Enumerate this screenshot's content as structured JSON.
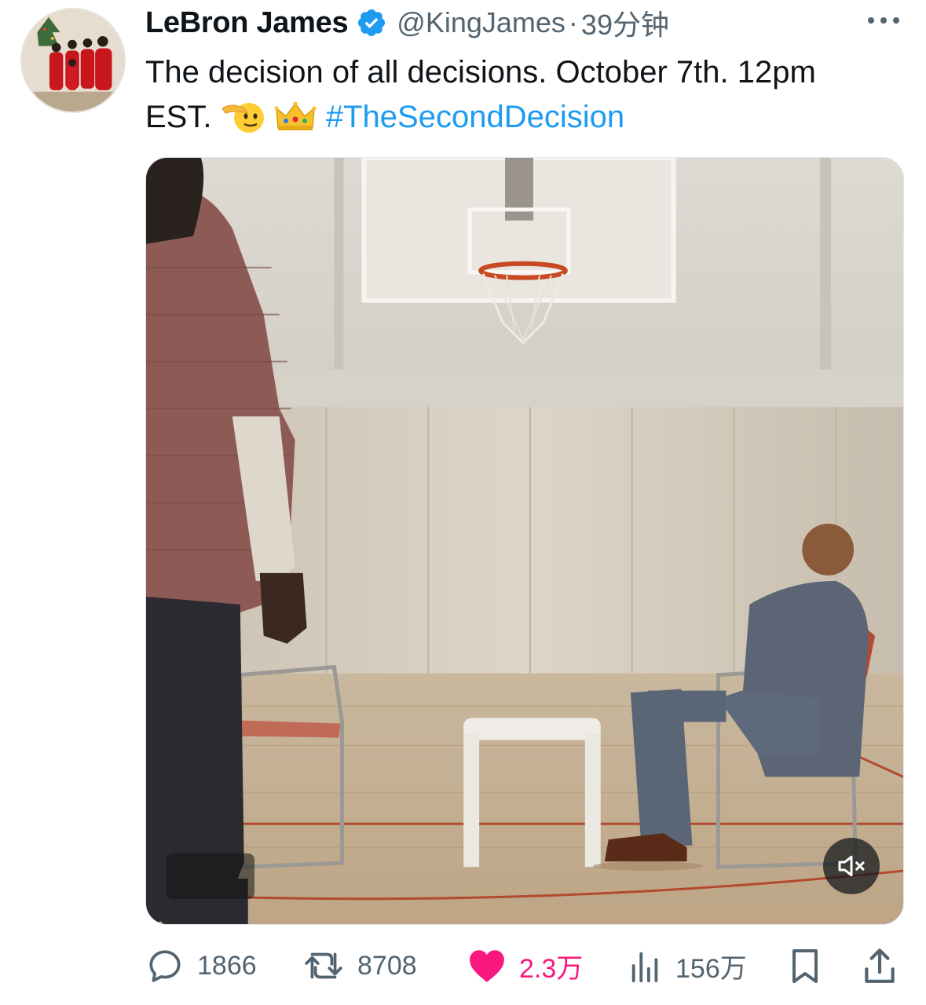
{
  "author": {
    "name": "LeBron James",
    "handle": "@KingJames",
    "separator": "·",
    "time": "39分钟",
    "verified": true
  },
  "tweet": {
    "text_line1": "The decision of all decisions. October 7th. 12pm",
    "text_line2_prefix": "EST.",
    "emojis": [
      "saluting-face",
      "crown"
    ],
    "hashtag": "#TheSecondDecision"
  },
  "media": {
    "type": "video",
    "muted": true,
    "description_icons": [
      "mute-icon"
    ]
  },
  "actions": {
    "replies": "1866",
    "retweets": "8708",
    "likes": "2.3万",
    "views": "156万"
  },
  "colors": {
    "link": "#1d9bf0",
    "like": "#f91880",
    "muted_text": "#536471",
    "text": "#0f1419"
  }
}
